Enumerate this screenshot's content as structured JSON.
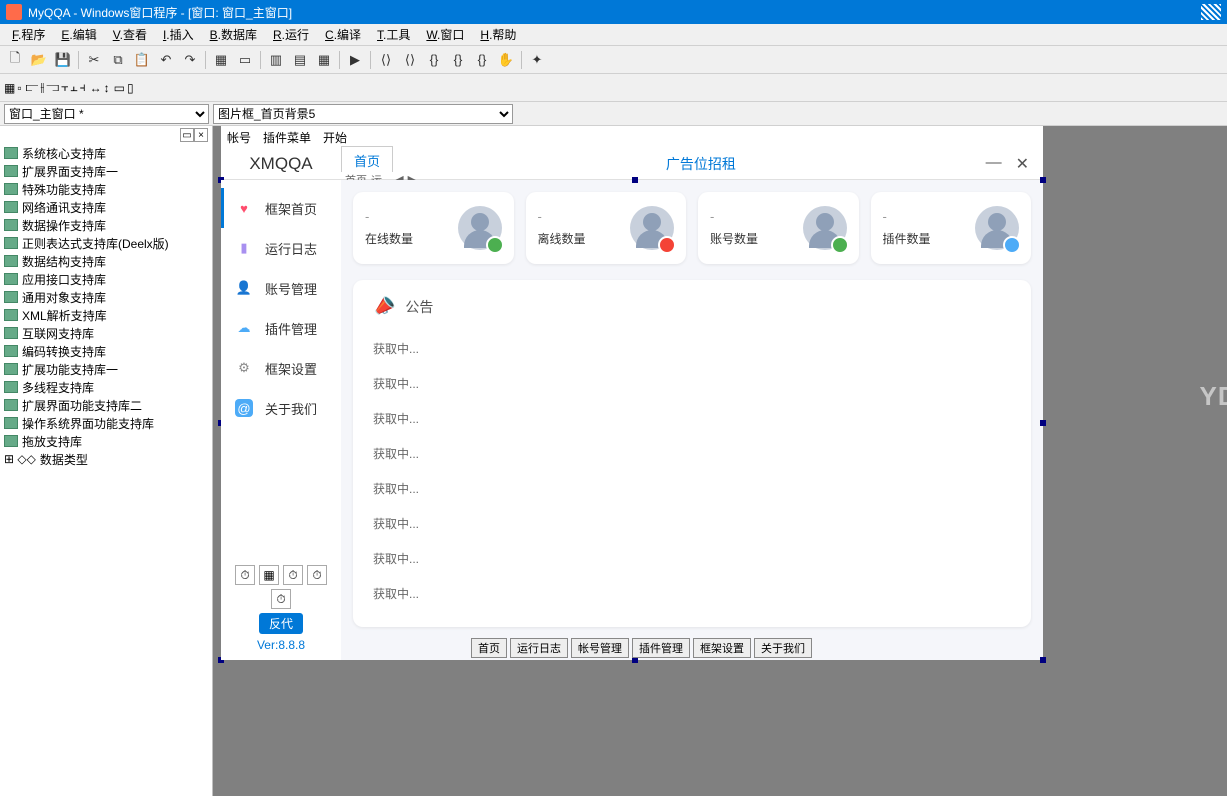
{
  "title": "MyQQA - Windows窗口程序 - [窗口: 窗口_主窗口]",
  "menu": [
    "F.程序",
    "E.编辑",
    "V.查看",
    "I.插入",
    "B.数据库",
    "R.运行",
    "C.编译",
    "T.工具",
    "W.窗口",
    "H.帮助"
  ],
  "dropdown1": "窗口_主窗口 *",
  "dropdown2": "图片框_首页背景5",
  "tree": [
    "系统核心支持库",
    "扩展界面支持库一",
    "特殊功能支持库",
    "网络通讯支持库",
    "数据操作支持库",
    "正则表达式支持库(Deelx版)",
    "数据结构支持库",
    "应用接口支持库",
    "通用对象支持库",
    "XML解析支持库",
    "互联网支持库",
    "编码转换支持库",
    "扩展功能支持库一",
    "多线程支持库",
    "扩展界面功能支持库二",
    "操作系统界面功能支持库",
    "拖放支持库"
  ],
  "tree_last_prefix": "⊞ ◇◇",
  "tree_last": "数据类型",
  "app": {
    "menu": [
      "帐号",
      "插件菜单",
      "开始"
    ],
    "brand": "XMQQA",
    "tab_active": "首页",
    "subtabs": [
      "首页",
      "运..."
    ],
    "ad": "广告位招租",
    "win_min": "—",
    "win_close": "✕",
    "sidebar": [
      {
        "icon": "heart",
        "label": "框架首页",
        "glyph": "♥"
      },
      {
        "icon": "book",
        "label": "运行日志",
        "glyph": "▮"
      },
      {
        "icon": "user",
        "label": "账号管理",
        "glyph": "👤"
      },
      {
        "icon": "cloud",
        "label": "插件管理",
        "glyph": "☁"
      },
      {
        "icon": "gear",
        "label": "框架设置",
        "glyph": "⚙"
      },
      {
        "icon": "at",
        "label": "关于我们",
        "glyph": "@"
      }
    ],
    "badge": "反代",
    "version": "Ver:8.8.8",
    "stats": [
      {
        "value": "-",
        "label": "在线数量",
        "dot": "bd-green"
      },
      {
        "value": "-",
        "label": "离线数量",
        "dot": "bd-red"
      },
      {
        "value": "-",
        "label": "账号数量",
        "dot": "bd-plus"
      },
      {
        "value": "-",
        "label": "插件数量",
        "dot": "bd-cloud"
      }
    ],
    "notice_title": "公告",
    "notices": [
      "获取中...",
      "获取中...",
      "获取中...",
      "获取中...",
      "获取中...",
      "获取中...",
      "获取中...",
      "获取中..."
    ],
    "bottom_tabs": [
      "首页",
      "运行日志",
      "帐号管理",
      "插件管理",
      "框架设置",
      "关于我们"
    ]
  },
  "watermark": "YDS源码网"
}
